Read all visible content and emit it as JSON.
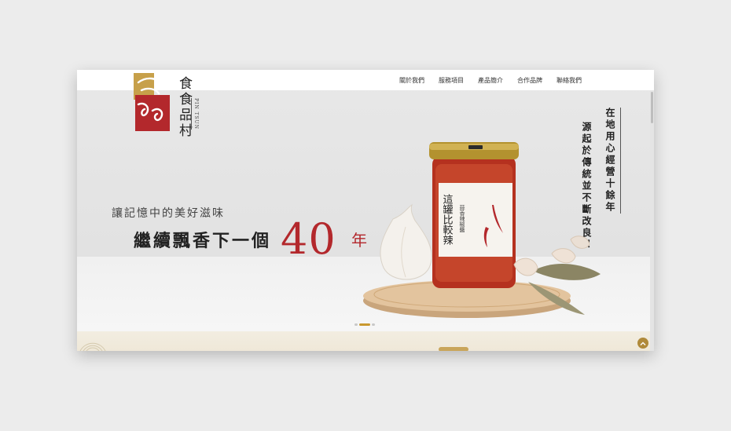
{
  "nav": {
    "items": [
      {
        "label": "關於我們"
      },
      {
        "label": "服務項目"
      },
      {
        "label": "產品簡介"
      },
      {
        "label": "合作品牌"
      },
      {
        "label": "聯絡我們"
      }
    ]
  },
  "brand": {
    "name": "食食品村",
    "sub": "PIN TSUN"
  },
  "hero": {
    "tagline_line1": "讓記憶中的美好滋味",
    "tagline_line2": "繼續飄香下一個",
    "big_number": "40",
    "big_unit": "年",
    "vertical_right": "在地用心經營十餘年",
    "vertical_left": "源起於傳統並不斷改良！"
  },
  "product": {
    "jar_label_main": "這罐比較辣",
    "jar_label_sub": "蒜香辣椒醬",
    "jar_badge": "品村食堂"
  },
  "slider": {
    "slide_count": 3,
    "active_index": 1
  },
  "colors": {
    "accent_red": "#b3282c",
    "gold": "#b08a3a"
  }
}
